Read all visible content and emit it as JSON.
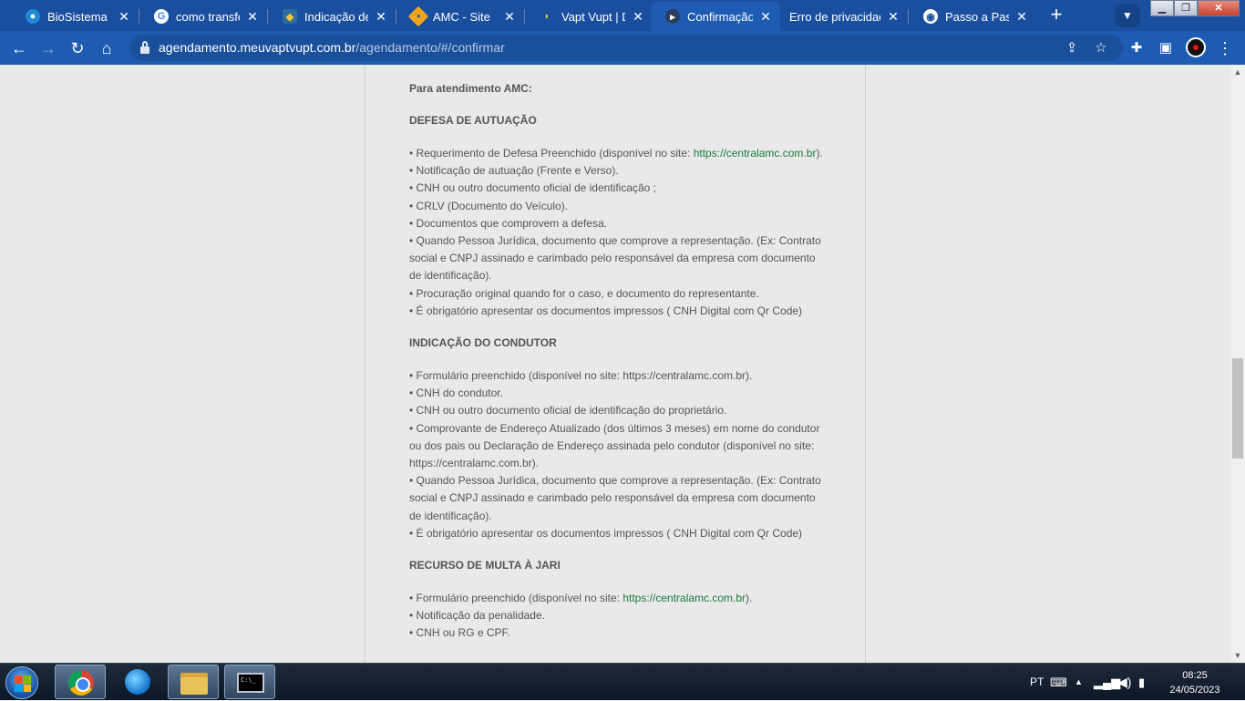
{
  "browser": {
    "tabs": [
      {
        "title": "BioSistema",
        "icon": "biosistema-icon",
        "active": false
      },
      {
        "title": "como transferi",
        "icon": "google-icon",
        "active": false
      },
      {
        "title": "Indicação de C",
        "icon": "crest-icon",
        "active": false
      },
      {
        "title": "AMC - Site",
        "icon": "amc-icon",
        "active": false
      },
      {
        "title": "Vapt Vupt | Du",
        "icon": "vaptvupt-icon",
        "active": false
      },
      {
        "title": "Confirmação |",
        "icon": "confirm-icon",
        "active": true
      },
      {
        "title": "Erro de privacidade",
        "icon": "",
        "active": false
      },
      {
        "title": "Passo a Passo",
        "icon": "globe-icon",
        "active": false
      }
    ],
    "close_symbol": "✕",
    "new_tab_symbol": "+",
    "url": {
      "domain": "agendamento.meuvaptvupt.com.br",
      "path": "/agendamento/#/confirmar"
    }
  },
  "page": {
    "intro": "Para atendimento AMC:",
    "sections": [
      {
        "heading": "DEFESA DE AUTUAÇÃO",
        "items": [
          {
            "text": "• Requerimento de Defesa Preenchido (disponível no site: ",
            "link": "https://centralamc.com.br",
            "after": ")."
          },
          {
            "text": "• Notificação de autuação (Frente e Verso)."
          },
          {
            "text": "• CNH ou outro documento oficial de identificação ;"
          },
          {
            "text": "• CRLV (Documento do Veículo)."
          },
          {
            "text": "• Documentos que comprovem a defesa."
          },
          {
            "text": "• Quando Pessoa Jurídica, documento que comprove a representação. (Ex: Contrato social e CNPJ assinado e carimbado pelo responsável da empresa com documento de identificação)."
          },
          {
            "text": "• Procuração original quando for o caso, e documento do representante."
          },
          {
            "text": "• É obrigatório apresentar os documentos impressos ( CNH Digital com Qr Code)"
          }
        ]
      },
      {
        "heading": "INDICAÇÃO DO CONDUTOR",
        "items": [
          {
            "text": "• Formulário preenchido (disponível no site: https://centralamc.com.br)."
          },
          {
            "text": "• CNH do condutor."
          },
          {
            "text": "• CNH ou outro documento oficial de identificação do proprietário."
          },
          {
            "text": "• Comprovante de Endereço Atualizado (dos últimos 3 meses) em nome do condutor ou dos pais ou Declaração de Endereço assinada pelo condutor (disponível no site: https://centralamc.com.br)."
          },
          {
            "text": "• Quando Pessoa Jurídica, documento que comprove a representação. (Ex: Contrato social e CNPJ assinado e carimbado pelo responsável da empresa com documento de identificação)."
          },
          {
            "text": "• É obrigatório apresentar os documentos impressos ( CNH Digital com Qr Code)"
          }
        ]
      },
      {
        "heading": "RECURSO DE MULTA À JARI",
        "items": [
          {
            "text": "• Formulário preenchido (disponível no site: ",
            "link": "https://centralamc.com.br",
            "after": ")."
          },
          {
            "text": "• Notificação da penalidade."
          },
          {
            "text": "• CNH ou RG e CPF."
          }
        ]
      }
    ]
  },
  "taskbar": {
    "language": "PT",
    "time": "08:25",
    "date": "24/05/2023"
  }
}
